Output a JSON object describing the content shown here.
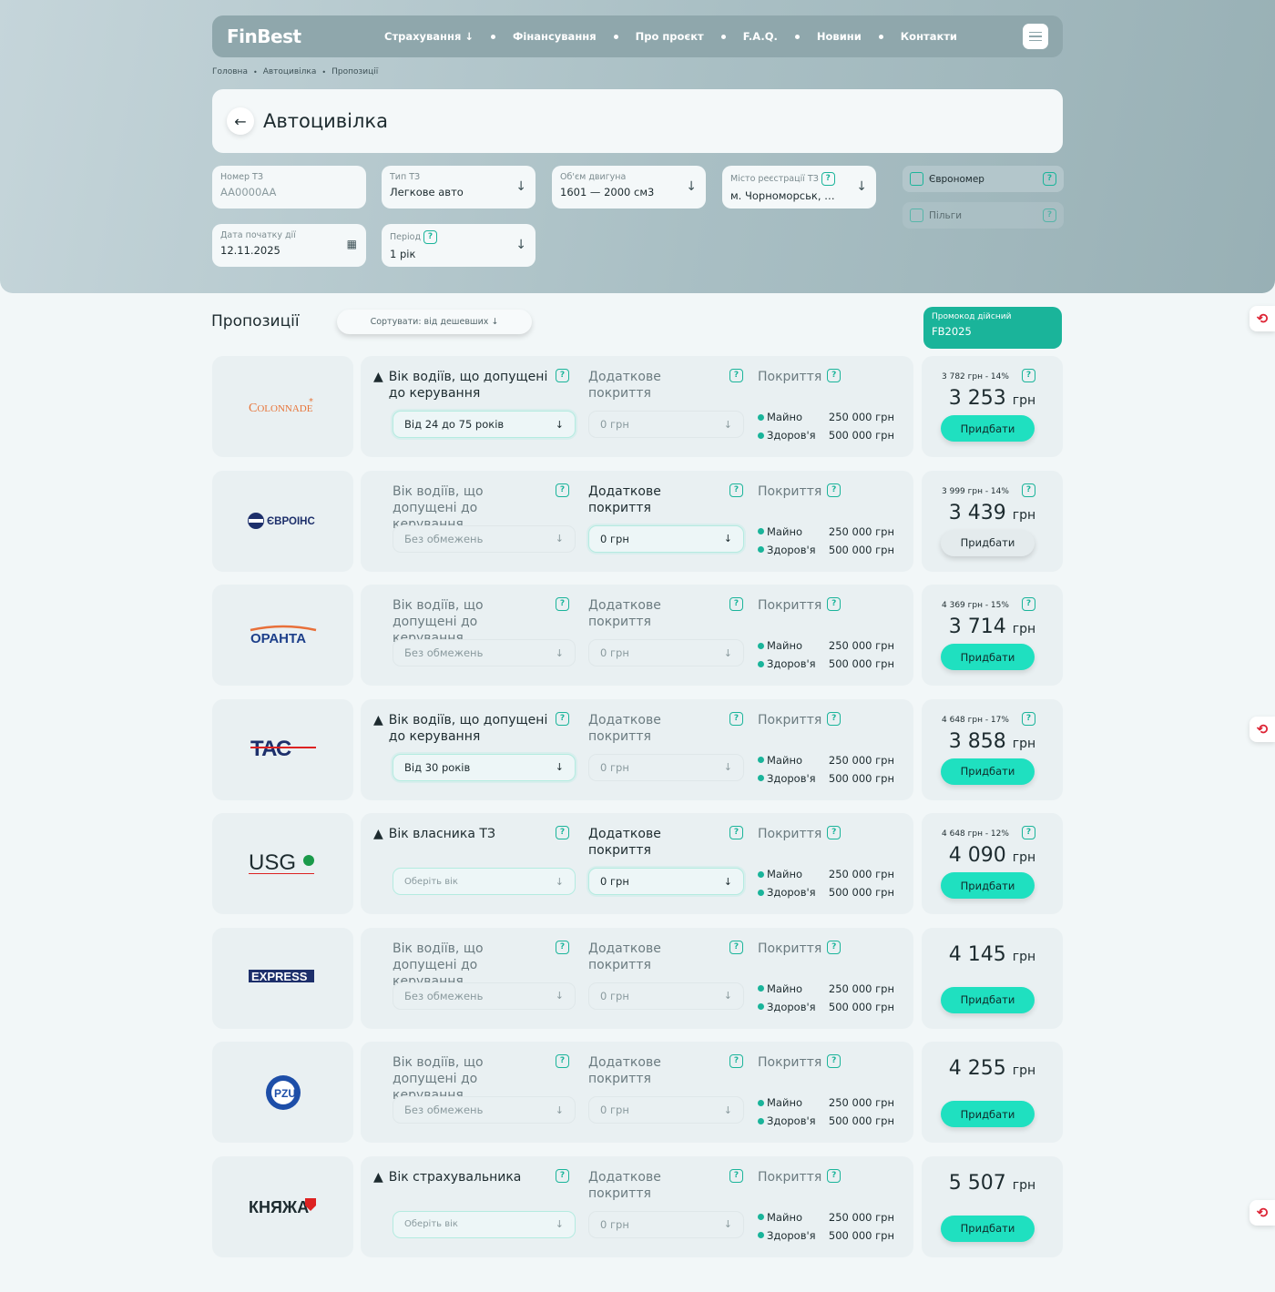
{
  "nav": {
    "logo": "FinBest",
    "links": [
      "Страхування ↓",
      "Фінансування",
      "Про проєкт",
      "F.A.Q.",
      "Новини",
      "Контакти"
    ]
  },
  "breadcrumbs": [
    "Головна",
    "Автоцивілка",
    "Пропозиції"
  ],
  "page_title": "Автоцивілка",
  "form": {
    "plate": {
      "label": "Номер ТЗ",
      "placeholder": "AA0000AA"
    },
    "vehicle_type": {
      "label": "Тип ТЗ",
      "value": "Легкове авто"
    },
    "engine": {
      "label": "Об'єм двигуна",
      "value": "1601 — 2000 см3"
    },
    "city": {
      "label": "Місто реєстрації ТЗ",
      "value": "м. Чорноморськ, Од..."
    },
    "start_date": {
      "label": "Дата початку дії",
      "value": "12.11.2025"
    },
    "period": {
      "label": "Період",
      "value": "1 рік"
    },
    "euro_plate": "Єврономер",
    "benefits": "Пільги"
  },
  "offers_title": "Пропозиції",
  "sort_label": "Сортувати: від дешевших ↓",
  "promo": {
    "label": "Промокод дійсний",
    "code": "FB2025"
  },
  "coverage_labels": {
    "property": "Майно",
    "health": "Здоров'я",
    "property_amount": "250 000 грн",
    "health_amount": "500 000 грн"
  },
  "extra_header": "Додаткове покриття",
  "coverage_header": "Покриття",
  "buy_label": "Придбати",
  "currency": "грн",
  "offers": [
    {
      "insurer": "COLONNADE",
      "age_header": "Вік водіїв, що допущені до керування",
      "age_value": "Від 24 до 75 років",
      "extra": "0 грн",
      "old": "3 782 грн - 14%",
      "price": "3 253",
      "warn": true,
      "age_active": true,
      "extra_active": false,
      "buy_grey": false
    },
    {
      "insurer": "ЄВРОІНС",
      "age_header": "Вік водіїв, що допущені до керування",
      "age_value": "Без обмежень",
      "extra": "0 грн",
      "old": "3 999 грн - 14%",
      "price": "3 439",
      "warn": false,
      "age_active": false,
      "extra_active": true,
      "buy_grey": true
    },
    {
      "insurer": "ОРАНТА",
      "age_header": "Вік водіїв, що допущені до керування",
      "age_value": "Без обмежень",
      "extra": "0 грн",
      "old": "4 369 грн - 15%",
      "price": "3 714",
      "warn": false,
      "age_active": false,
      "extra_active": false,
      "buy_grey": false
    },
    {
      "insurer": "ТАС",
      "age_header": "Вік водіїв, що допущені до керування",
      "age_value": "Від 30 років",
      "extra": "0 грн",
      "old": "4 648 грн - 17%",
      "price": "3 858",
      "warn": true,
      "age_active": true,
      "extra_active": false,
      "buy_grey": false
    },
    {
      "insurer": "USG",
      "age_header": "Вік власника ТЗ",
      "age_value": "Оберіть вік",
      "extra": "0 грн",
      "old": "4 648 грн - 12%",
      "price": "4 090",
      "warn": true,
      "age_active": true,
      "extra_active": true,
      "buy_grey": false,
      "age_placeholder": true
    },
    {
      "insurer": "EXPRESS",
      "age_header": "Вік водіїв, що допущені до керування",
      "age_value": "Без обмежень",
      "extra": "0 грн",
      "old": "",
      "price": "4 145",
      "warn": false,
      "age_active": false,
      "extra_active": false,
      "buy_grey": false
    },
    {
      "insurer": "PZU",
      "age_header": "Вік водіїв, що допущені до керування",
      "age_value": "Без обмежень",
      "extra": "0 грн",
      "old": "",
      "price": "4 255",
      "warn": false,
      "age_active": false,
      "extra_active": false,
      "buy_grey": false
    },
    {
      "insurer": "КНЯЖА",
      "age_header": "Вік страхувальника",
      "age_value": "Оберіть вік",
      "extra": "0 грн",
      "old": "",
      "price": "5 507",
      "warn": true,
      "age_active": true,
      "extra_active": false,
      "buy_grey": false,
      "age_placeholder": true
    }
  ],
  "colors": {
    "accent": "#1ab49a",
    "buy": "#1fe0c0",
    "hero": "#a9bfc4"
  }
}
